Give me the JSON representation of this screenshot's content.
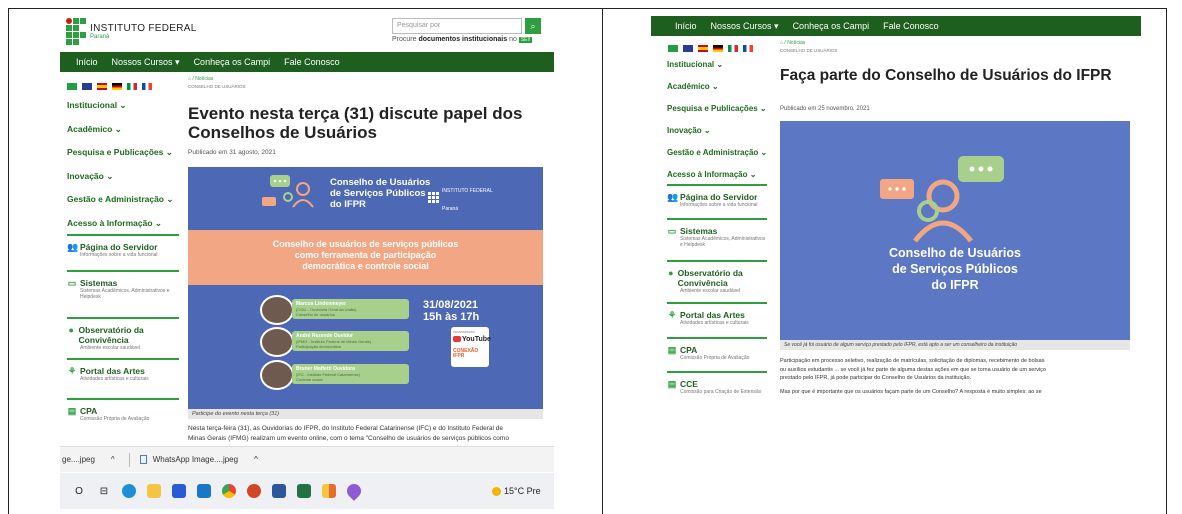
{
  "left_page": {
    "logo_name": "INSTITUTO FEDERAL",
    "logo_sub": "Paraná",
    "search_placeholder": "Pesquisar por",
    "search_hint_prefix": "Procure ",
    "search_hint_bold": "documentos institucionais",
    "search_hint_suffix": " no ",
    "search_hint_pill": "SEI!",
    "nav": [
      "Início",
      "Nossos Cursos ▾",
      "Conheça os Campi",
      "Fale Conosco"
    ],
    "menu": [
      "Institucional ⌄",
      "Acadêmico ⌄",
      "Pesquisa e Publicações ⌄",
      "Inovação ⌄",
      "Gestão e Administração ⌄",
      "Acesso à Informação ⌄"
    ],
    "boxes": [
      {
        "icon": "👥",
        "title": "Página do Servidor",
        "sub": "Informações sobre a vida funcional"
      },
      {
        "icon": "▭",
        "title": "Sistemas",
        "sub": "Sistemas Acadêmicos, Administrativos e Helpdesk"
      },
      {
        "icon": "●",
        "title": "Observatório da Convivência",
        "sub": "Ambiente escolar saudável"
      },
      {
        "icon": "⚘",
        "title": "Portal das Artes",
        "sub": "Atividades artísticas e culturais"
      },
      {
        "icon": "▤",
        "title": "CPA",
        "sub": "Comissão Própria de Avaliação"
      }
    ],
    "breadcrumb": "⌂ / Notícias",
    "breadcrumb_sub": "Conselho de Usuários",
    "headline": "Evento nesta terça (31) discute papel dos Conselhos de Usuários",
    "published": "Publicado em 31 agosto, 2021",
    "banner": {
      "title_l1": "Conselho de Usuários",
      "title_l2": "de Serviços Públicos",
      "title_l3": "do IFPR",
      "logo_text": "INSTITUTO FEDERAL",
      "logo_sub": "Paraná",
      "mid_l1": "Conselho de usuários de serviços públicos",
      "mid_l2": "como ferramenta de participação",
      "mid_l3": "democrática e controle social",
      "speakers": [
        {
          "name": "Marcos Lindenmeyer",
          "desc1": "(OGU - Ouvidoria Geral da União)",
          "desc2": "Conselho de usuários"
        },
        {
          "name": "André Rezende Ouvidor",
          "desc1": "(IFMG - Instituto Federal de Minas Gerais)",
          "desc2": "Participação democrática"
        },
        {
          "name": "Bruner Maffetti Ouvidora",
          "desc1": "(IFC - Instituto Federal Catarinense)",
          "desc2": "Controle social"
        }
      ],
      "date": "31/08/2021",
      "time": "15h às 17h",
      "transmission": "TRANSMISSÃO",
      "youtube": "YouTube",
      "channel_l1": "CONEXÃO",
      "channel_l2": "IFPR"
    },
    "caption": "Participe do evento nesta terça (31)",
    "body_l1": "Nesta terça-feira (31), as Ouvidorias do IFPR, do Instituto Federal Catarinense (IFC) e do Instituto Federal de",
    "body_l2": "Minas Gerais (IFMG) realizam um evento online, com o tema \"Conselho de usuários de serviços públicos como"
  },
  "downloads": {
    "item1": "ge....jpeg",
    "item1_caret": "^",
    "item2": "WhatsApp Image....jpeg",
    "item2_caret": "^"
  },
  "taskbar": {
    "search_glyph": "O",
    "taskview_glyph": "⊟",
    "weather": "15°C Pre"
  },
  "right_page": {
    "nav": [
      "Início",
      "Nossos Cursos ▾",
      "Conheça os Campi",
      "Fale Conosco"
    ],
    "menu": [
      "Institucional ⌄",
      "Acadêmico ⌄",
      "Pesquisa e Publicações ⌄",
      "Inovação ⌄",
      "Gestão e Administração ⌄",
      "Acesso à Informação ⌄"
    ],
    "boxes": [
      {
        "icon": "👥",
        "title": "Página do Servidor",
        "sub": "Informações sobre a vida funcional"
      },
      {
        "icon": "▭",
        "title": "Sistemas",
        "sub": "Sistemas Acadêmicos, Administrativos e Helpdesk"
      },
      {
        "icon": "●",
        "title": "Observatório da Convivência",
        "sub": "Ambiente escolar saudável"
      },
      {
        "icon": "⚘",
        "title": "Portal das Artes",
        "sub": "Atividades artísticas e culturais"
      },
      {
        "icon": "▤",
        "title": "CPA",
        "sub": "Comissão Própria de Avaliação"
      },
      {
        "icon": "▤",
        "title": "CCE",
        "sub": "Comissão para Criação de Extensão"
      }
    ],
    "breadcrumb": "⌂ / Notícias",
    "breadcrumb_sub": "Conselho de Usuários",
    "headline": "Faça parte do Conselho de Usuários do IFPR",
    "published": "Publicado em 25 novembro, 2021",
    "banner_l1": "Conselho de Usuários",
    "banner_l2": "de Serviços Públicos",
    "banner_l3": "do IFPR",
    "caption": "Se você já foi usuário de algum serviço prestado pelo IFPR, está apto a ser um conselheiro da instituição",
    "body_l1": "Participação em processo seletivo, realização de matrículas, solicitação de diplomas, recebimento de bolsas",
    "body_l2": "ou auxílios estudantis ... se você já fez parte de alguma destas ações em que se torna usuário de um serviço",
    "body_l3": "prestado pelo IFPR, já pode participar do Conselho de Usuários da instituição.",
    "body_l4": "Mas por que é importante que os usuários façam parte de um Conselho? A resposta é muito simples: ao se"
  },
  "colors": {
    "brand_green": "#2f9e41",
    "nav_dark_green": "#1e5e1e",
    "banner_blue": "#4d68b5",
    "banner_orange": "#f2a683"
  }
}
